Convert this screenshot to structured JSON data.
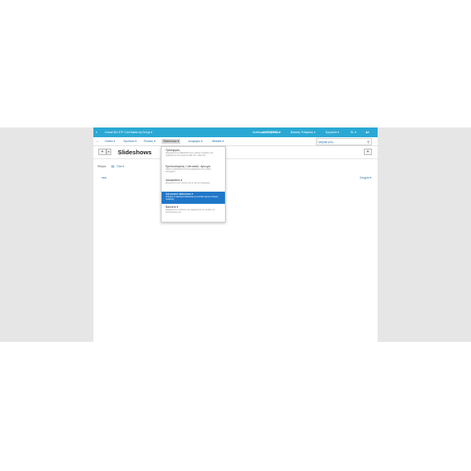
{
  "topbar": {
    "home_icon": "home-icon",
    "app_title": "Cursal Dlx OTF-Cart Marks by Dot.gr ▾",
    "menu1": "Διαθέσιμες Ρυθμίσεις ▾",
    "menu2": "ΑΝΟΙΧΤΡΕΣ ▾",
    "menu3": "Βασικές Ρυθμίσεις ▾",
    "menu4": "Εργαλεία ▾",
    "lang": "EL ▾",
    "user_icon": "user-icon"
  },
  "menubar": {
    "home": "⌂",
    "items": [
      "Orders ▾",
      "Προϊόντα ▾",
      "Πελάτες ▾",
      "Slideshows ▾",
      "Αναφορές ▾",
      "Website ▾"
    ],
    "search_placeholder": "Γρήγορη ροή..."
  },
  "page": {
    "add_button": "+",
    "add_dropdown": "▾",
    "title": "Slideshows",
    "right_button": "+",
    "filter_label": "Φίλτρα:",
    "filter_value": "Όλα ▾",
    "list_label": "new",
    "list_right": "Στοιχεία ▾"
  },
  "dropdown": {
    "items": [
      {
        "title": "Προσφορές",
        "desc": "Διαχειριστείτε τα slideshows και τις εικόνες προβολής που εμφανίζονται στην αρχική σελίδα του e-shop σας."
      },
      {
        "title": "Εμπλουτισμένη / Lite κατάλ. άγνωμα",
        "desc": "Ορίστε τα slideshows που θα εμφανίζονται στις σελίδες κατηγοριών."
      },
      {
        "title": "Newsletters ▾",
        "desc": "Ενημερώστε τους πελάτες σας με νέα και προσφορές."
      },
      {
        "title": "Advanced slideshow ▾",
        "desc": "Ρυθμίστε τα advanced slideshows με επιπλέον εφέ και επιλογές προβολής."
      },
      {
        "title": "Banners ▾",
        "desc": "Διαχειριστείτε τα banners που εμφανίζονται στις σελίδες του καταστήματος σας."
      }
    ]
  },
  "colors": {
    "topbar": "#2aa8d4",
    "highlight": "#2077c9",
    "link": "#1a6fa6"
  }
}
